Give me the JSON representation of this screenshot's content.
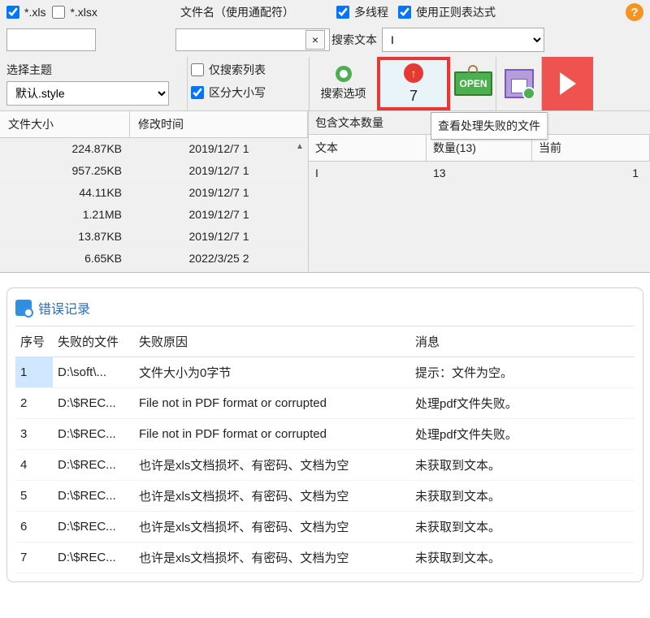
{
  "filters": {
    "xls_label": "*.xls",
    "xlsx_label": "*.xlsx",
    "xls_checked": true,
    "xlsx_checked": false,
    "filter_input": ""
  },
  "filename": {
    "label": "文件名（使用通配符）",
    "value": "",
    "clear": "×",
    "placeholder": ""
  },
  "options_top": {
    "multithread": "多线程",
    "regex": "使用正则表达式",
    "search_text_label": "搜索文本",
    "search_input_value": "I"
  },
  "help": "?",
  "theme": {
    "label": "选择主题",
    "value": "默认.style"
  },
  "options_mid": {
    "list_only": "仅搜索列表",
    "case_sensitive": "区分大小写"
  },
  "search_options_btn": "搜索选项",
  "failed_count": "7",
  "tooltip": "查看处理失败的文件",
  "open_label": "OPEN",
  "file_table": {
    "col_size": "文件大小",
    "col_mtime": "修改时间",
    "rows": [
      {
        "size": "224.87KB",
        "mtime": "2019/12/7 1"
      },
      {
        "size": "957.25KB",
        "mtime": "2019/12/7 1"
      },
      {
        "size": "44.11KB",
        "mtime": "2019/12/7 1"
      },
      {
        "size": "1.21MB",
        "mtime": "2019/12/7 1"
      },
      {
        "size": "13.87KB",
        "mtime": "2019/12/7 1"
      },
      {
        "size": "6.65KB",
        "mtime": "2022/3/25 2"
      }
    ]
  },
  "text_panel": {
    "title": "包含文本数量",
    "col_text": "文本",
    "col_qty": "数量(13)",
    "col_cur": "当前",
    "row": {
      "text": "I",
      "qty": "13",
      "cur": "1"
    }
  },
  "error_panel": {
    "title": "错误记录",
    "col_seq": "序号",
    "col_file": "失败的文件",
    "col_reason": "失败原因",
    "col_msg": "消息",
    "rows": [
      {
        "seq": "1",
        "file": "D:\\soft\\...",
        "reason": "文件大小为0字节",
        "msg": "提示：文件为空。"
      },
      {
        "seq": "2",
        "file": "D:\\$REC...",
        "reason": "File not in PDF format or corrupted",
        "msg": "处理pdf文件失败。"
      },
      {
        "seq": "3",
        "file": "D:\\$REC...",
        "reason": "File not in PDF format or corrupted",
        "msg": "处理pdf文件失败。"
      },
      {
        "seq": "4",
        "file": "D:\\$REC...",
        "reason": "也许是xls文档损坏、有密码、文档为空",
        "msg": "未获取到文本。"
      },
      {
        "seq": "5",
        "file": "D:\\$REC...",
        "reason": "也许是xls文档损坏、有密码、文档为空",
        "msg": "未获取到文本。"
      },
      {
        "seq": "6",
        "file": "D:\\$REC...",
        "reason": "也许是xls文档损坏、有密码、文档为空",
        "msg": "未获取到文本。"
      },
      {
        "seq": "7",
        "file": "D:\\$REC...",
        "reason": "也许是xls文档损坏、有密码、文档为空",
        "msg": "未获取到文本。"
      }
    ]
  }
}
